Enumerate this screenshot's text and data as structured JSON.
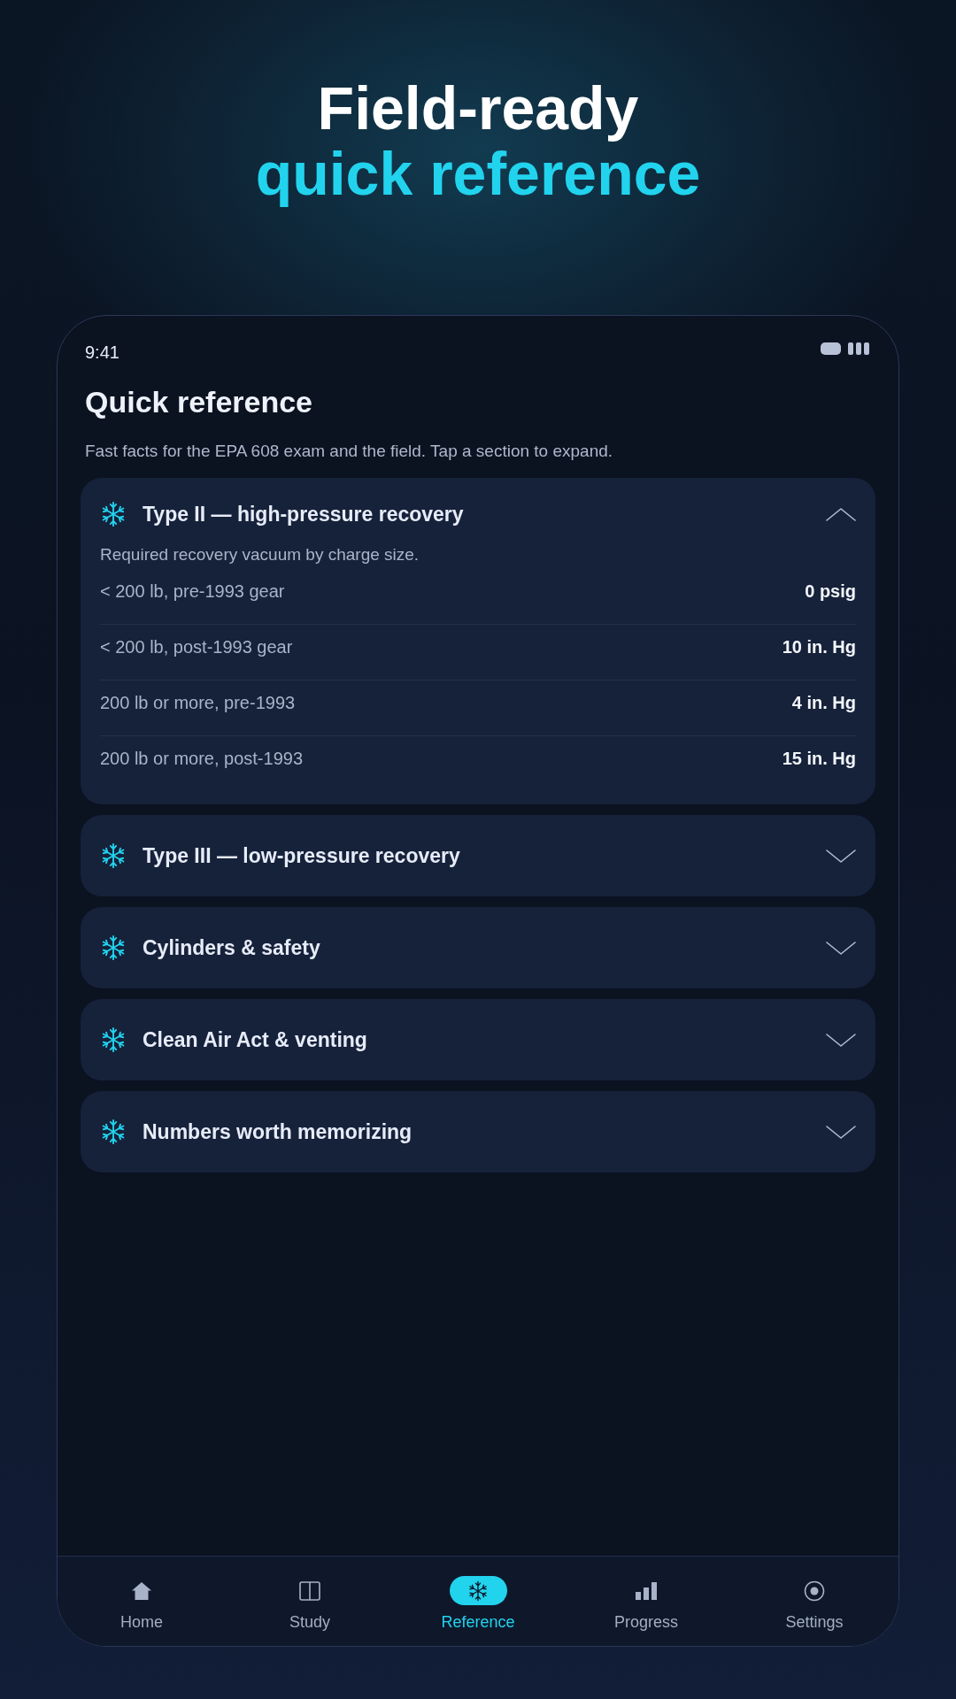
{
  "hero": {
    "line_1": "Field-ready",
    "line_2": "quick reference"
  },
  "status_bar": {
    "time": "9:41"
  },
  "screen": {
    "title": "Quick reference",
    "subtitle": "Fast facts for the EPA 608 exam and the field. Tap a section to expand."
  },
  "sections": [
    {
      "title": "Type II — high-pressure recovery",
      "expanded": true,
      "note": "Required recovery vacuum by charge size.",
      "rows": [
        {
          "label": "< 200 lb, pre-1993 gear",
          "value": "0 psig"
        },
        {
          "label": "< 200 lb, post-1993 gear",
          "value": "10 in. Hg"
        },
        {
          "label": "200 lb or more, pre-1993",
          "value": "4 in. Hg"
        },
        {
          "label": "200 lb or more, post-1993",
          "value": "15 in. Hg"
        }
      ]
    },
    {
      "title": "Type III — low-pressure recovery",
      "expanded": false
    },
    {
      "title": "Cylinders & safety",
      "expanded": false
    },
    {
      "title": "Clean Air Act & venting",
      "expanded": false
    },
    {
      "title": "Numbers worth memorizing",
      "expanded": false
    }
  ],
  "tab_bar": [
    {
      "label": "Home",
      "selected": false
    },
    {
      "label": "Study",
      "selected": false
    },
    {
      "label": "Reference",
      "selected": true
    },
    {
      "label": "Progress",
      "selected": false
    },
    {
      "label": "Settings",
      "selected": false
    }
  ]
}
